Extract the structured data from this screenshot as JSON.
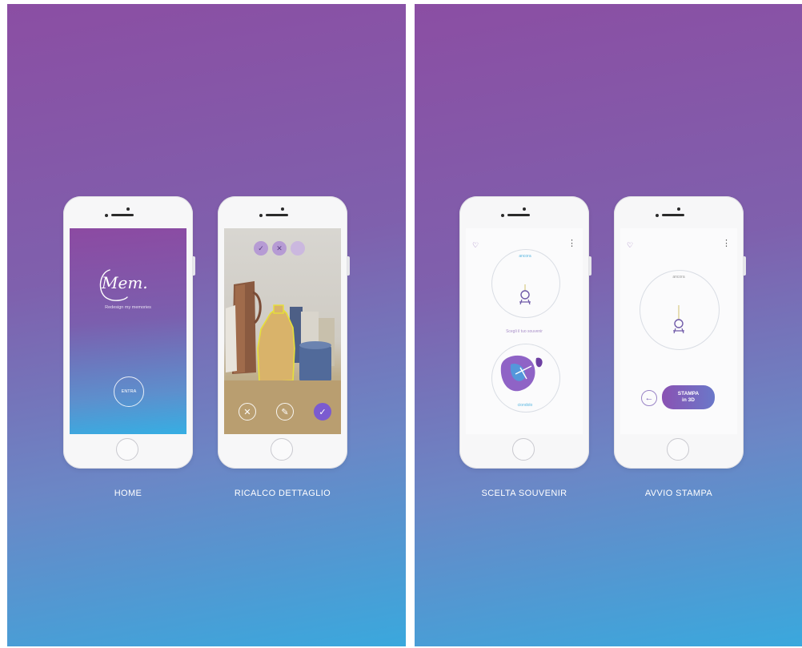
{
  "left_panel": {
    "captions": [
      "HOME",
      "RICALCO DETTAGLIO"
    ]
  },
  "right_panel": {
    "captions": [
      "SCELTA SOUVENIR",
      "AVVIO STAMPA"
    ]
  },
  "home_screen": {
    "logo_text": "Mem.",
    "tagline": "Redesign my memories",
    "enter_button": "ENTRA"
  },
  "trace_screen": {
    "top_icons": [
      "check-bottle-icon",
      "cross-bottle-icon",
      "empty-circle-icon"
    ],
    "bottom_icons": [
      "cancel-icon",
      "edit-icon",
      "confirm-icon"
    ]
  },
  "souvenir_screen": {
    "dial_label": "ancora",
    "choose_text": "Scegli il tuo souvenir",
    "option_label": "ciondolo"
  },
  "print_screen": {
    "dial_label": "ancora",
    "print_button_line1": "STAMPA",
    "print_button_line2": "in 3D"
  },
  "colors": {
    "gradient_top": "#8b4ea3",
    "gradient_bottom": "#3aa8dd",
    "accent": "#7b5bd0"
  }
}
